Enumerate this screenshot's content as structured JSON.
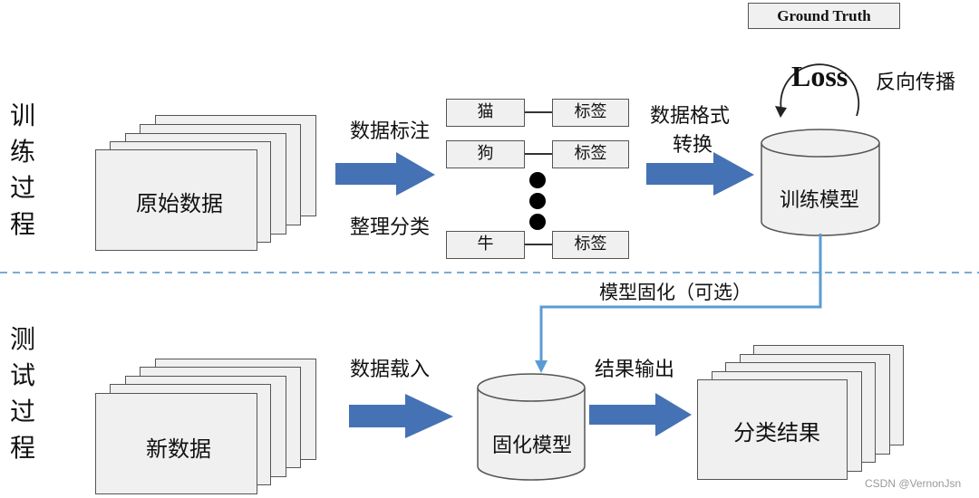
{
  "sections": {
    "train": "训练过程",
    "test": "测试过程"
  },
  "train": {
    "raw_data": "原始数据",
    "annotate_label": "数据标注",
    "sort_label": "整理分类",
    "pairs": [
      {
        "item": "猫",
        "tag": "标签"
      },
      {
        "item": "狗",
        "tag": "标签"
      },
      {
        "item": "牛",
        "tag": "标签"
      }
    ],
    "format_label_line1": "数据格式",
    "format_label_line2": "转换",
    "model": "训练模型",
    "ground_truth": "Ground Truth",
    "loss": "Loss",
    "backprop": "反向传播"
  },
  "link": {
    "freeze_label": "模型固化（可选）"
  },
  "test": {
    "new_data": "新数据",
    "load_label": "数据载入",
    "frozen_model": "固化模型",
    "output_label": "结果输出",
    "result": "分类结果"
  },
  "colors": {
    "arrow": "#4472b4",
    "connector": "#5b9bd5",
    "box_fill": "#f0f0f0",
    "dashed_divider": "#7aaad6"
  },
  "watermark": "CSDN @VernonJsn"
}
